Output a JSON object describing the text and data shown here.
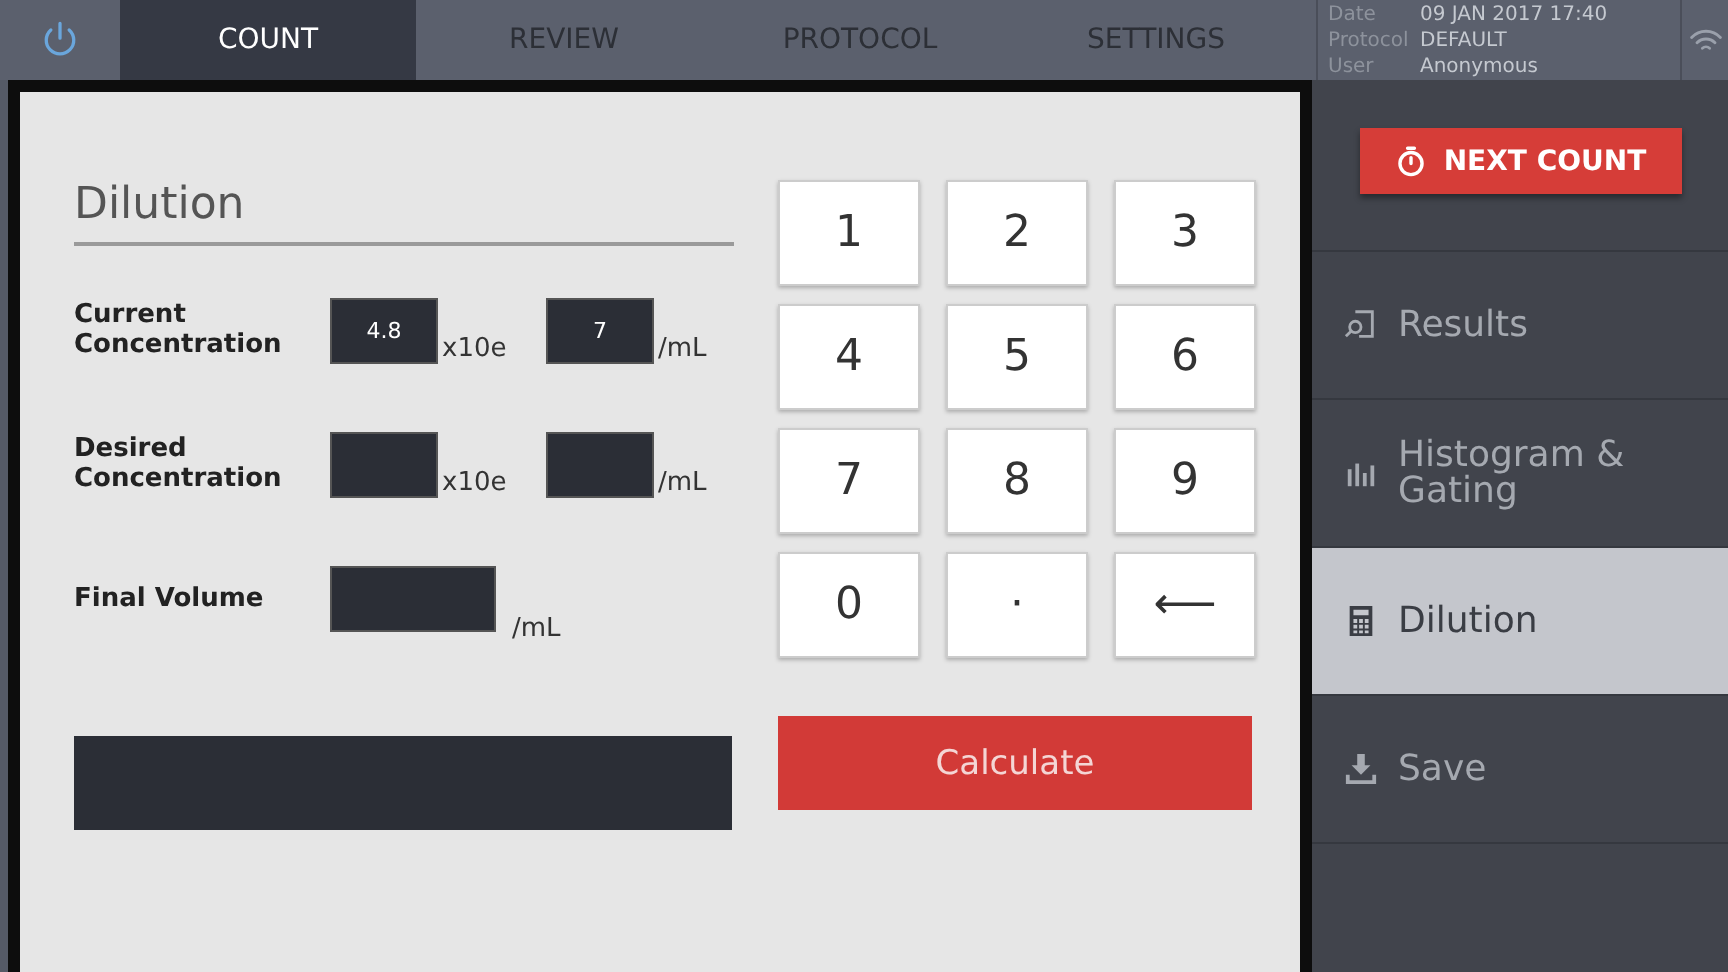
{
  "tabs": [
    {
      "label": "COUNT",
      "selected": true
    },
    {
      "label": "REVIEW",
      "selected": false
    },
    {
      "label": "PROTOCOL",
      "selected": false
    },
    {
      "label": "SETTINGS",
      "selected": false
    }
  ],
  "status": [
    {
      "label": "Date",
      "value": "09 JAN 2017 17:40"
    },
    {
      "label": "Protocol",
      "value": "DEFAULT"
    },
    {
      "label": "User",
      "value": "Anonymous"
    }
  ],
  "dialog": {
    "title": "Dilution",
    "rows": [
      {
        "label": "Current Concentration",
        "kind": "concentration",
        "mantissa": "4.8",
        "multiplier": "x10e",
        "exponent": "7",
        "unit": "/mL"
      },
      {
        "label": "Desired Concentration",
        "kind": "concentration",
        "multiplier": "x10e",
        "unit": "/mL"
      },
      {
        "label": "Final Volume",
        "kind": "volume",
        "unit": "/mL"
      }
    ],
    "keys": [
      "1",
      "2",
      "3",
      "4",
      "5",
      "6",
      "7",
      "8",
      "9",
      "0",
      "·",
      "⟵"
    ],
    "calculate": "Calculate"
  },
  "sidebar": {
    "next_count": "NEXT COUNT",
    "items": [
      {
        "label": "Results",
        "kind": "results",
        "selected": false
      },
      {
        "label": "Histogram & Gating",
        "kind": "histogram",
        "selected": false
      },
      {
        "label": "Dilution",
        "kind": "calculator",
        "selected": true
      },
      {
        "label": "Save",
        "kind": "save",
        "selected": false
      }
    ]
  }
}
